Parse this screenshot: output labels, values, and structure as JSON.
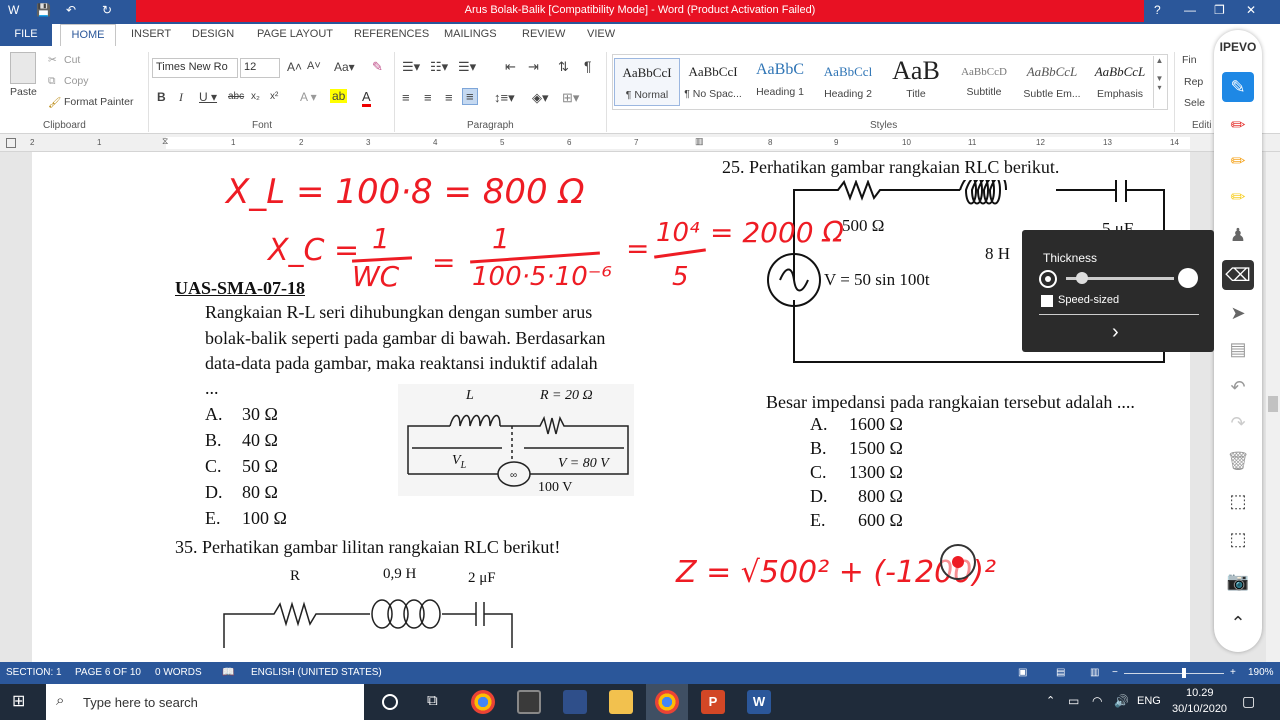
{
  "titlebar": {
    "title": "Arus Bolak-Balik [Compatibility Mode] - Word (Product Activation Failed)",
    "help": "?",
    "min": "—",
    "restore": "❐",
    "close": "✕"
  },
  "tabs": [
    "FILE",
    "HOME",
    "INSERT",
    "DESIGN",
    "PAGE LAYOUT",
    "REFERENCES",
    "MAILINGS",
    "REVIEW",
    "VIEW"
  ],
  "ribbon": {
    "clipboard": {
      "paste": "Paste",
      "cut": "Cut",
      "copy": "Copy",
      "format_painter": "Format Painter",
      "label": "Clipboard"
    },
    "font": {
      "name": "Times New Ro",
      "size": "12",
      "label": "Font"
    },
    "paragraph": {
      "label": "Paragraph"
    },
    "styles": {
      "label": "Styles",
      "items": [
        {
          "preview": "AaBbCcI",
          "name": "¶ Normal"
        },
        {
          "preview": "AaBbCcI",
          "name": "¶ No Spac..."
        },
        {
          "preview": "AaBbC",
          "name": "Heading 1"
        },
        {
          "preview": "AaBbCcl",
          "name": "Heading 2"
        },
        {
          "preview": "AaB",
          "name": "Title"
        },
        {
          "preview": "AaBbCcD",
          "name": "Subtitle"
        },
        {
          "preview": "AaBbCcL",
          "name": "Subtle Em..."
        },
        {
          "preview": "AaBbCcL",
          "name": "Emphasis"
        }
      ]
    },
    "editing": {
      "find": "Fin",
      "replace": "Rep",
      "select": "Sele",
      "label": "Editi"
    }
  },
  "ruler": {
    "numbers": [
      "2",
      "1",
      "1",
      "2",
      "3",
      "4",
      "5",
      "6",
      "7",
      "8",
      "9",
      "10",
      "11",
      "12",
      "13",
      "14",
      "15"
    ]
  },
  "document": {
    "q25": "25.   Perhatikan gambar rangkaian RLC berikut.",
    "circuit1": {
      "r": "500 Ω",
      "l": "8 H",
      "c": "5 μF",
      "v": "V = 50 sin 100t"
    },
    "heading": "UAS-SMA-07-18",
    "para1": "Rangkaian R-L seri dihubungkan dengan sumber arus",
    "para2": "bolak-balik seperti pada gambar di bawah. Berdasarkan",
    "para3": "data-data pada gambar, maka reaktansi induktif adalah",
    "para4": "...",
    "answers_left": [
      {
        "letter": "A.",
        "value": "30 Ω"
      },
      {
        "letter": "B.",
        "value": "40 Ω"
      },
      {
        "letter": "C.",
        "value": "50 Ω"
      },
      {
        "letter": "D.",
        "value": "80 Ω"
      },
      {
        "letter": "E.",
        "value": "100 Ω"
      }
    ],
    "circuit2": {
      "l": "L",
      "r": "R = 20 Ω",
      "vl": "V",
      "vl_sub": "L",
      "vr": "V = 80 V",
      "v": "100 V"
    },
    "q_impedance": "Besar impedansi pada rangkaian tersebut adalah ....",
    "answers_right": [
      {
        "letter": "A.",
        "value": "1600 Ω"
      },
      {
        "letter": "B.",
        "value": "1500 Ω"
      },
      {
        "letter": "C.",
        "value": "1300 Ω"
      },
      {
        "letter": "D.",
        "value": "800 Ω"
      },
      {
        "letter": "E.",
        "value": "600 Ω"
      }
    ],
    "q35": "35.   Perhatikan gambar lilitan rangkaian RLC berikut!",
    "circuit3": {
      "r": "R",
      "l": "0,9 H",
      "c": "2 μF"
    }
  },
  "ink": {
    "line1": "X_L = 100·8 = 800 Ω",
    "line2a": "X_C =",
    "frac1_num": "1",
    "frac1_den": "WC",
    "frac2_num": "1",
    "frac2_den": "100·5·10⁻⁶",
    "frac3_num": "10⁴",
    "frac3_den": "5",
    "eq": "= 2000 Ω",
    "z": "Z = √500² + (-1200)²"
  },
  "thickness_popup": {
    "title": "Thickness",
    "speed_sized": "Speed-sized"
  },
  "ipevo": {
    "logo": "IPEVO"
  },
  "status": {
    "section": "SECTION: 1",
    "page": "PAGE 6 OF 10",
    "words": "0 WORDS",
    "language": "ENGLISH (UNITED STATES)",
    "zoom": "190%"
  },
  "taskbar": {
    "search_placeholder": "Type here to search",
    "lang": "ENG",
    "time": "10.29",
    "date": "30/10/2020"
  }
}
